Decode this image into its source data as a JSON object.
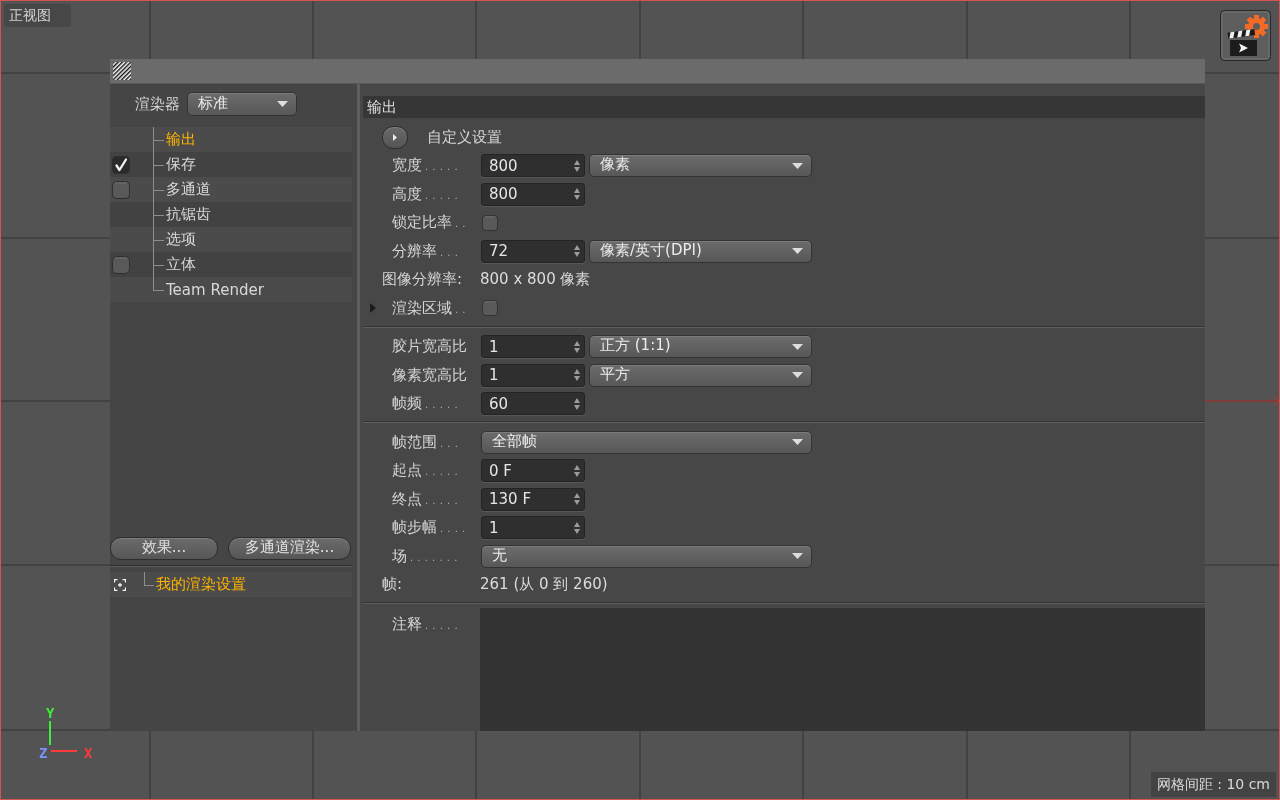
{
  "viewport": {
    "view_name": "正视图",
    "grid_spacing": "网格间距 : 10 cm",
    "axes": [
      {
        "kind": "y",
        "label": "Y"
      },
      {
        "kind": "z",
        "label": "Z"
      },
      {
        "kind": "x",
        "label": "X"
      }
    ]
  },
  "dialog": {
    "renderer": {
      "label": "渲染器",
      "value": "标准"
    },
    "sections": [
      {
        "label": "输出",
        "kind": "plain",
        "selected": true
      },
      {
        "label": "保存",
        "kind": "toggle",
        "checked": true,
        "selected": false
      },
      {
        "label": "多通道",
        "kind": "toggle",
        "checked": false,
        "selected": false
      },
      {
        "label": "抗锯齿",
        "kind": "plain",
        "selected": false
      },
      {
        "label": "选项",
        "kind": "plain",
        "selected": false
      },
      {
        "label": "立体",
        "kind": "toggle",
        "checked": false,
        "selected": false
      },
      {
        "label": "Team Render",
        "kind": "plain",
        "selected": false
      }
    ],
    "buttons": [
      "效果...",
      "多通道渲染..."
    ],
    "presets": [
      {
        "label": "我的渲染设置",
        "selected": true
      }
    ],
    "panel_title": "输出",
    "groups": [
      {
        "rows": [
          {
            "kind": "preset",
            "label": "自定义设置"
          },
          {
            "kind": "number",
            "label": "宽度",
            "leader": ". . . . .",
            "value": "800",
            "unit": "像素"
          },
          {
            "kind": "number",
            "label": "高度",
            "leader": ". . . . .",
            "value": "800"
          },
          {
            "kind": "checkbox",
            "label": "锁定比率",
            "leader": ". .",
            "checked": false
          },
          {
            "kind": "number",
            "label": "分辨率",
            "leader": ". . .",
            "value": "72",
            "unit": "像素/英寸(DPI)"
          },
          {
            "kind": "info",
            "label": "图像分辨率:",
            "value": "800 x 800 像素"
          },
          {
            "kind": "checkbox",
            "label": "渲染区域",
            "leader": ". .",
            "checked": false,
            "expanded": false
          }
        ]
      },
      {
        "rows": [
          {
            "kind": "number",
            "label": "胶片宽高比",
            "value": "1",
            "unit": "正方 (1:1)"
          },
          {
            "kind": "number",
            "label": "像素宽高比",
            "value": "1",
            "unit": "平方"
          },
          {
            "kind": "number",
            "label": "帧频",
            "leader": ". . . . .",
            "value": "60"
          }
        ]
      },
      {
        "rows": [
          {
            "kind": "select",
            "label": "帧范围",
            "leader": ". . .",
            "value": "全部帧"
          },
          {
            "kind": "number",
            "label": "起点",
            "leader": ". . . . .",
            "value": "0 F"
          },
          {
            "kind": "number",
            "label": "终点",
            "leader": ". . . . .",
            "value": "130 F"
          },
          {
            "kind": "number",
            "label": "帧步幅",
            "leader": ". . . .",
            "value": "1"
          },
          {
            "kind": "select",
            "label": "场",
            "leader": ". . . . . . .",
            "value": "无"
          },
          {
            "kind": "info",
            "label": "帧:",
            "value": "261 (从 0 到 260)"
          }
        ]
      },
      {
        "rows": [
          {
            "kind": "textarea",
            "label": "注释",
            "leader": ". . . . ."
          }
        ]
      }
    ]
  }
}
